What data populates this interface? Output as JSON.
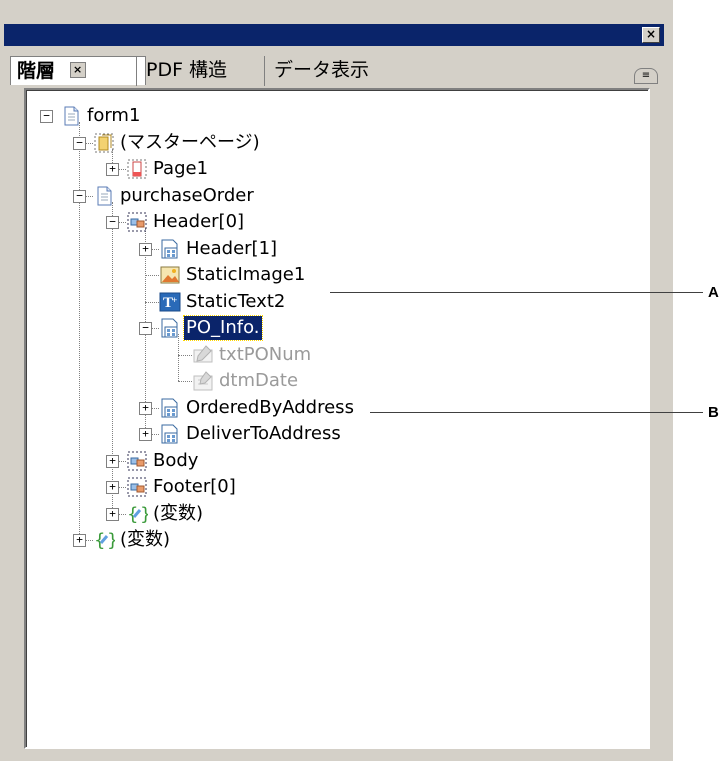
{
  "panel": {
    "close_label": "×",
    "tabs": [
      {
        "label": "階層"
      },
      {
        "label": "PDF 構造"
      },
      {
        "label": "データ表示"
      }
    ],
    "tab_close_label": "×",
    "menu_icon": "≡"
  },
  "tree": {
    "nodes": [
      {
        "label": "form1",
        "icon": "document-icon",
        "expander": "minus"
      },
      {
        "label": "(マスターページ)",
        "icon": "master-pages-icon",
        "expander": "minus"
      },
      {
        "label": "Page1",
        "icon": "page-icon",
        "expander": "plus"
      },
      {
        "label": "purchaseOrder",
        "icon": "document-icon",
        "expander": "minus"
      },
      {
        "label": "Header[0]",
        "icon": "subform-icon",
        "expander": "minus"
      },
      {
        "label": "Header[1]",
        "icon": "subform-group-icon",
        "expander": "plus"
      },
      {
        "label": "StaticImage1",
        "icon": "image-icon",
        "expander": ""
      },
      {
        "label": "StaticText2",
        "icon": "text-icon",
        "expander": ""
      },
      {
        "label": "PO_Info.",
        "icon": "subform-group-icon",
        "expander": "minus",
        "selected": true
      },
      {
        "label": "txtPONum",
        "icon": "textfield-icon",
        "expander": "",
        "dimmed": true
      },
      {
        "label": "dtmDate",
        "icon": "datefield-icon",
        "expander": "",
        "dimmed": true
      },
      {
        "label": "OrderedByAddress",
        "icon": "subform-group-icon",
        "expander": "plus"
      },
      {
        "label": "DeliverToAddress",
        "icon": "subform-group-icon",
        "expander": "plus"
      },
      {
        "label": "Body",
        "icon": "subform-icon",
        "expander": "plus"
      },
      {
        "label": "Footer[0]",
        "icon": "subform-icon",
        "expander": "plus"
      },
      {
        "label": "(変数)",
        "icon": "variables-icon",
        "expander": "plus"
      },
      {
        "label": "(変数)",
        "icon": "variables-icon",
        "expander": "plus"
      }
    ]
  },
  "callouts": {
    "a": "A",
    "b": "B"
  },
  "colors": {
    "selection": "#0a246a",
    "titlebar": "#0a246a",
    "panel_bg": "#d4d0c8"
  }
}
